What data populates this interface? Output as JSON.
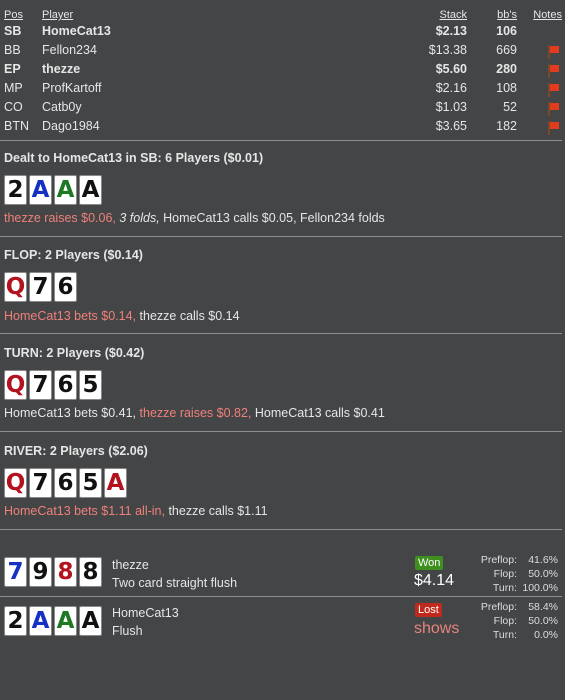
{
  "players_table": {
    "headers": {
      "pos": "Pos",
      "player": "Player",
      "stack": "Stack",
      "bbs": "bb's",
      "notes": "Notes"
    },
    "rows": [
      {
        "pos": "SB",
        "player": "HomeCat13",
        "stack": "$2.13",
        "bbs": "106",
        "bold": true,
        "flag": false
      },
      {
        "pos": "BB",
        "player": "Fellon234",
        "stack": "$13.38",
        "bbs": "669",
        "bold": false,
        "flag": true
      },
      {
        "pos": "EP",
        "player": "thezze",
        "stack": "$5.60",
        "bbs": "280",
        "bold": true,
        "flag": true
      },
      {
        "pos": "MP",
        "player": "ProfKartoff",
        "stack": "$2.16",
        "bbs": "108",
        "bold": false,
        "flag": true
      },
      {
        "pos": "CO",
        "player": "Catb0y",
        "stack": "$1.03",
        "bbs": "52",
        "bold": false,
        "flag": true
      },
      {
        "pos": "BTN",
        "player": "Dago1984",
        "stack": "$3.65",
        "bbs": "182",
        "bold": false,
        "flag": true
      }
    ],
    "flag_icon": "red-flag-icon"
  },
  "preflop": {
    "title": "Dealt to HomeCat13 in SB: 6 Players ($0.01)",
    "cards": [
      {
        "rank": "2",
        "suit": "s"
      },
      {
        "rank": "A",
        "suit": "d"
      },
      {
        "rank": "A",
        "suit": "c"
      },
      {
        "rank": "A",
        "suit": "s"
      }
    ],
    "action": {
      "a1": "thezze raises $0.06,",
      "a2": "3 folds,",
      "a3": "HomeCat13 calls $0.05, Fellon234 folds"
    }
  },
  "flop": {
    "title": "FLOP: 2 Players ($0.14)",
    "cards": [
      {
        "rank": "Q",
        "suit": "h"
      },
      {
        "rank": "7",
        "suit": "s"
      },
      {
        "rank": "6",
        "suit": "s"
      }
    ],
    "action": {
      "a1": "HomeCat13 bets $0.14,",
      "a2": "thezze calls $0.14"
    }
  },
  "turn": {
    "title": "TURN: 2 Players ($0.42)",
    "cards": [
      {
        "rank": "Q",
        "suit": "h"
      },
      {
        "rank": "7",
        "suit": "s"
      },
      {
        "rank": "6",
        "suit": "s"
      },
      {
        "rank": "5",
        "suit": "s"
      }
    ],
    "action": {
      "a1": "HomeCat13 bets $0.41,",
      "a2": "thezze raises $0.82,",
      "a3": "HomeCat13 calls $0.41"
    }
  },
  "river": {
    "title": "RIVER: 2 Players ($2.06)",
    "cards": [
      {
        "rank": "Q",
        "suit": "h"
      },
      {
        "rank": "7",
        "suit": "s"
      },
      {
        "rank": "6",
        "suit": "s"
      },
      {
        "rank": "5",
        "suit": "s"
      },
      {
        "rank": "A",
        "suit": "h"
      }
    ],
    "action": {
      "a1": "HomeCat13 bets $1.11 all-in,",
      "a2": "thezze calls $1.11"
    }
  },
  "results": [
    {
      "cards": [
        {
          "rank": "7",
          "suit": "d"
        },
        {
          "rank": "9",
          "suit": "s"
        },
        {
          "rank": "8",
          "suit": "h"
        },
        {
          "rank": "8",
          "suit": "s"
        }
      ],
      "player": "thezze",
      "hand": "Two card straight flush",
      "badge": "Won",
      "amount": "$4.14",
      "stats": [
        {
          "label": "Preflop:",
          "value": "41.6%"
        },
        {
          "label": "Flop:",
          "value": "50.0%"
        },
        {
          "label": "Turn:",
          "value": "100.0%"
        }
      ]
    },
    {
      "cards": [
        {
          "rank": "2",
          "suit": "s"
        },
        {
          "rank": "A",
          "suit": "d"
        },
        {
          "rank": "A",
          "suit": "c"
        },
        {
          "rank": "A",
          "suit": "s"
        }
      ],
      "player": "HomeCat13",
      "hand": "Flush",
      "badge": "Lost",
      "amount": "shows",
      "stats": [
        {
          "label": "Preflop:",
          "value": "58.4%"
        },
        {
          "label": "Flop:",
          "value": "50.0%"
        },
        {
          "label": "Turn:",
          "value": "0.0%"
        }
      ]
    }
  ]
}
